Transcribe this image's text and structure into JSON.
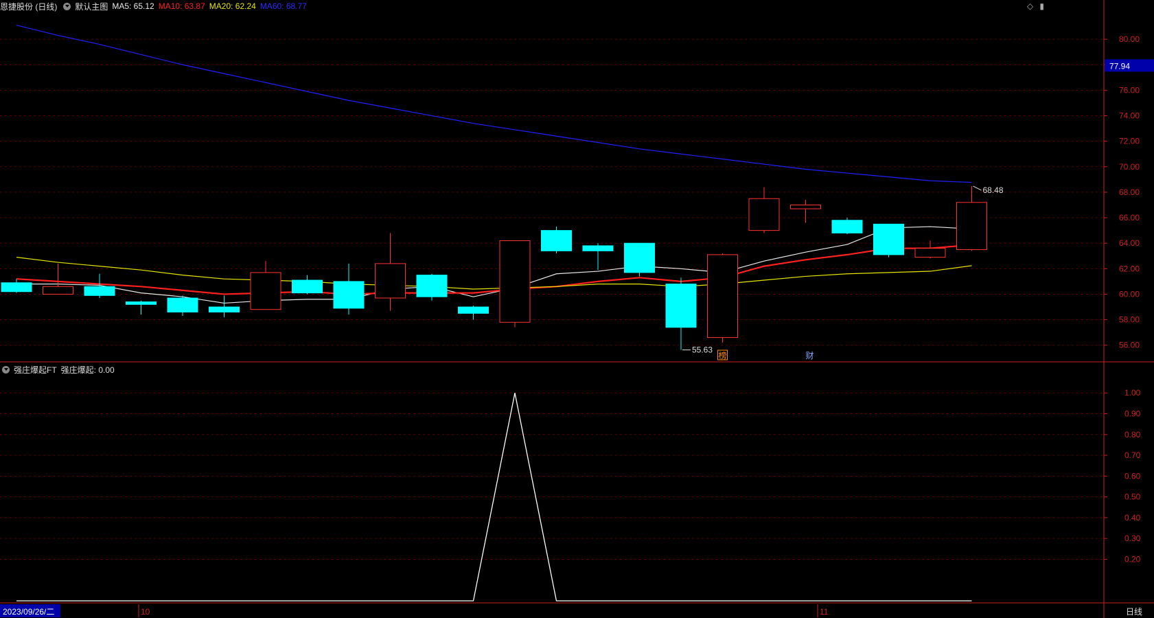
{
  "header": {
    "stock": "恩捷股份 (日线)",
    "template": "默认主图",
    "ma5": "MA5: 65.12",
    "ma10": "MA10: 63.87",
    "ma20": "MA20: 62.24",
    "ma60": "MA60: 68.77"
  },
  "sub_header": {
    "indicator": "强庄爆起FT",
    "value": "强庄爆起: 0.00"
  },
  "price_tag": "77.94",
  "annotations": {
    "high_label": "68.48",
    "low_label": "55.63",
    "marker1": "榜",
    "marker2": "财"
  },
  "date_axis": {
    "start": "2023/09/26/二",
    "m10": "10",
    "m11": "11",
    "period": "日线"
  },
  "colors": {
    "up": "#ff3333",
    "down": "#00ffff",
    "ma5": "#e8e8e8",
    "ma10": "#ff2020",
    "ma20": "#e6e600",
    "ma60": "#2020ff",
    "grid": "#5a0000",
    "axis": "#cc2020"
  },
  "chart_data": [
    {
      "type": "candlestick",
      "title": "恩捷股份 (日线)",
      "ylim": [
        54.8,
        82.0
      ],
      "yticks": [
        "56.00",
        "58.00",
        "60.00",
        "62.00",
        "64.00",
        "66.00",
        "68.00",
        "70.00",
        "72.00",
        "74.00",
        "76.00",
        "78.00",
        "80.00"
      ],
      "candles": [
        {
          "o": 60.9,
          "h": 61.2,
          "l": 60.1,
          "c": 60.2
        },
        {
          "o": 60.0,
          "h": 62.4,
          "l": 60.0,
          "c": 60.6
        },
        {
          "o": 60.6,
          "h": 61.6,
          "l": 59.7,
          "c": 59.9
        },
        {
          "o": 59.4,
          "h": 59.5,
          "l": 58.4,
          "c": 59.2
        },
        {
          "o": 59.7,
          "h": 59.9,
          "l": 58.3,
          "c": 58.6
        },
        {
          "o": 59.0,
          "h": 59.9,
          "l": 58.2,
          "c": 58.6
        },
        {
          "o": 58.8,
          "h": 62.6,
          "l": 58.8,
          "c": 61.7
        },
        {
          "o": 61.1,
          "h": 61.5,
          "l": 60.0,
          "c": 60.1
        },
        {
          "o": 61.0,
          "h": 62.4,
          "l": 58.4,
          "c": 58.9
        },
        {
          "o": 59.7,
          "h": 64.8,
          "l": 58.7,
          "c": 62.4
        },
        {
          "o": 61.5,
          "h": 61.6,
          "l": 59.5,
          "c": 59.8
        },
        {
          "o": 59.0,
          "h": 59.1,
          "l": 58.0,
          "c": 58.5
        },
        {
          "o": 57.8,
          "h": 64.2,
          "l": 57.4,
          "c": 64.2
        },
        {
          "o": 65.0,
          "h": 65.3,
          "l": 63.2,
          "c": 63.4
        },
        {
          "o": 63.8,
          "h": 64.0,
          "l": 61.9,
          "c": 63.4
        },
        {
          "o": 64.0,
          "h": 64.0,
          "l": 61.4,
          "c": 61.7
        },
        {
          "o": 60.8,
          "h": 61.3,
          "l": 55.63,
          "c": 57.4
        },
        {
          "o": 56.6,
          "h": 63.2,
          "l": 56.2,
          "c": 63.1
        },
        {
          "o": 65.0,
          "h": 68.4,
          "l": 64.8,
          "c": 67.5
        },
        {
          "o": 66.7,
          "h": 67.4,
          "l": 65.6,
          "c": 67.0
        },
        {
          "o": 65.8,
          "h": 66.0,
          "l": 64.7,
          "c": 64.8
        },
        {
          "o": 65.5,
          "h": 65.5,
          "l": 62.9,
          "c": 63.1
        },
        {
          "o": 62.9,
          "h": 64.2,
          "l": 62.8,
          "c": 63.6
        },
        {
          "o": 63.5,
          "h": 68.48,
          "l": 63.4,
          "c": 67.2
        }
      ],
      "series": [
        {
          "name": "MA5",
          "values": [
            60.8,
            60.8,
            60.7,
            60.1,
            59.8,
            59.3,
            59.5,
            59.6,
            59.6,
            60.4,
            60.6,
            59.8,
            60.5,
            61.6,
            61.8,
            62.2,
            62.0,
            61.7,
            62.6,
            63.3,
            63.9,
            65.2,
            65.3,
            65.12
          ]
        },
        {
          "name": "MA10",
          "values": [
            61.2,
            61.0,
            60.8,
            60.6,
            60.3,
            60.0,
            60.1,
            60.2,
            60.0,
            60.1,
            60.1,
            60.1,
            60.4,
            60.6,
            61.0,
            61.3,
            61.0,
            61.3,
            62.2,
            62.7,
            63.1,
            63.6,
            63.6,
            63.87
          ]
        },
        {
          "name": "MA20",
          "values": [
            62.9,
            62.5,
            62.2,
            61.9,
            61.5,
            61.2,
            61.1,
            61.0,
            60.8,
            60.7,
            60.6,
            60.4,
            60.5,
            60.6,
            60.8,
            60.8,
            60.6,
            60.8,
            61.1,
            61.4,
            61.6,
            61.7,
            61.8,
            62.24
          ]
        },
        {
          "name": "MA60",
          "values": [
            81.1,
            80.3,
            79.6,
            78.8,
            78.0,
            77.3,
            76.6,
            75.9,
            75.2,
            74.6,
            74.0,
            73.4,
            72.9,
            72.4,
            71.9,
            71.4,
            71.0,
            70.6,
            70.2,
            69.8,
            69.5,
            69.2,
            68.9,
            68.77
          ]
        }
      ]
    },
    {
      "type": "line",
      "title": "强庄爆起FT",
      "ylim": [
        0.0,
        1.08
      ],
      "yticks": [
        "0.20",
        "0.30",
        "0.40",
        "0.50",
        "0.60",
        "0.70",
        "0.80",
        "0.90",
        "1.00"
      ],
      "series": [
        {
          "name": "强庄爆起",
          "values": [
            0,
            0,
            0,
            0,
            0,
            0,
            0,
            0,
            0,
            0,
            0,
            0,
            1,
            0,
            0,
            0,
            0,
            0,
            0,
            0,
            0,
            0,
            0,
            0
          ]
        }
      ]
    }
  ]
}
